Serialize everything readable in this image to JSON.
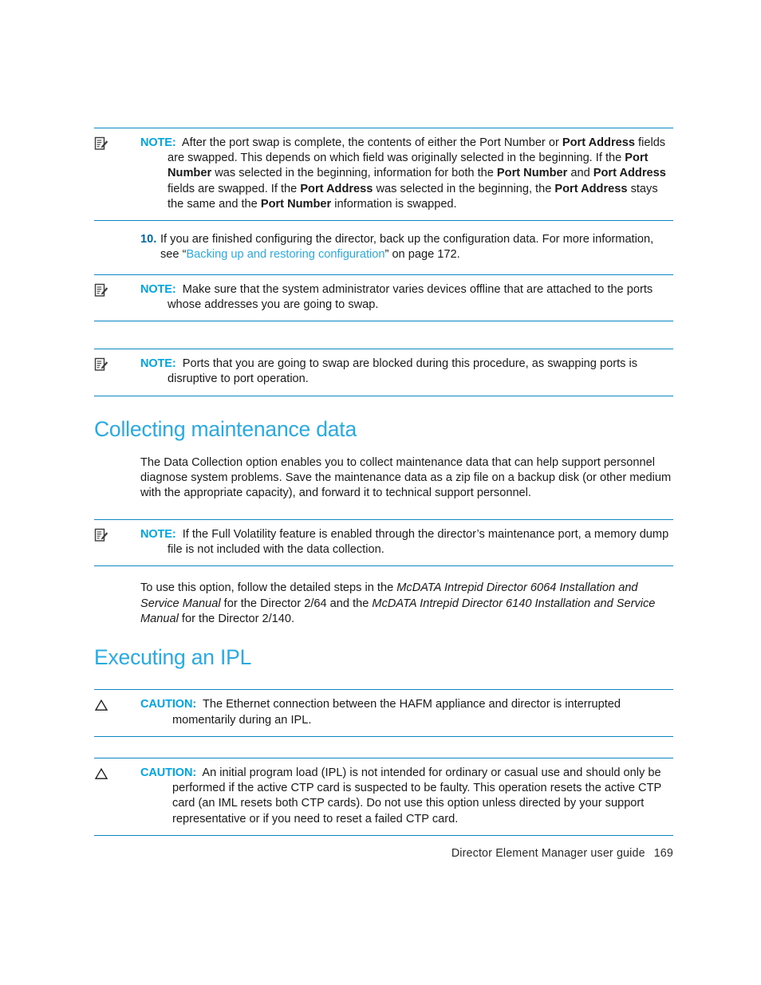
{
  "document": {
    "footer": {
      "guide_title": "Director Element Manager user guide",
      "page_number": "169"
    },
    "colors": {
      "heading": "#29abe2",
      "label": "#00a5e3",
      "rule": "#0d87c4",
      "link": "#29abe2",
      "step_number": "#0069a5",
      "body_text": "#1a1a1a"
    },
    "blocks": [
      {
        "kind": "note",
        "icon": "note-pencil-icon",
        "label": "NOTE:",
        "text": "After the port swap is complete, the contents of either the Port Number or ",
        "runs": [
          {
            "text": "After the port swap is complete, the contents of either the Port Number or ",
            "style": "normal"
          },
          {
            "text": "Port Address",
            "style": "bold"
          },
          {
            "text": " fields are swapped. This depends on which field was originally selected in the beginning. If the ",
            "style": "normal"
          },
          {
            "text": "Port Number",
            "style": "bold"
          },
          {
            "text": " was selected in the beginning, information for both the ",
            "style": "normal"
          },
          {
            "text": "Port Number",
            "style": "bold"
          },
          {
            "text": " and ",
            "style": "normal"
          },
          {
            "text": "Port Address",
            "style": "bold"
          },
          {
            "text": " fields are swapped. If the ",
            "style": "normal"
          },
          {
            "text": "Port Address",
            "style": "bold"
          },
          {
            "text": " was selected in the beginning, the ",
            "style": "normal"
          },
          {
            "text": "Port Address",
            "style": "bold"
          },
          {
            "text": " stays the same and the ",
            "style": "normal"
          },
          {
            "text": "Port Number",
            "style": "bold"
          },
          {
            "text": " information is swapped.",
            "style": "normal"
          }
        ]
      },
      {
        "kind": "step",
        "number": "10.",
        "text_before_link": "If you are finished configuring the director, back up the configuration data. For more information, see “",
        "link_text": "Backing up and restoring configuration",
        "text_after_link": "” on page 172."
      },
      {
        "kind": "note",
        "icon": "note-pencil-icon",
        "label": "NOTE:",
        "text": "Make sure that the system administrator varies devices offline that are attached to the ports whose addresses you are going to swap."
      },
      {
        "kind": "note",
        "icon": "note-pencil-icon",
        "label": "NOTE:",
        "text": "Ports that you are going to swap are blocked during this procedure, as swapping ports is disruptive to port operation."
      },
      {
        "kind": "heading",
        "text": "Collecting maintenance data"
      },
      {
        "kind": "paragraph",
        "text": "The Data Collection option enables you to collect maintenance data that can help support personnel diagnose system problems. Save the maintenance data as a zip file on a backup disk (or other medium with the appropriate capacity), and forward it to technical support personnel."
      },
      {
        "kind": "note",
        "icon": "note-pencil-icon",
        "label": "NOTE:",
        "text": "If the Full Volatility feature is enabled through the director’s maintenance port, a memory dump file is not included with the data collection."
      },
      {
        "kind": "paragraph-mixed",
        "runs": [
          {
            "text": "To use this option, follow the detailed steps in the ",
            "style": "normal"
          },
          {
            "text": "McDATA Intrepid Director 6064 Installation and Service Manual",
            "style": "italic"
          },
          {
            "text": " for the Director 2/64 and the ",
            "style": "normal"
          },
          {
            "text": "McDATA Intrepid Director 6140 Installation and Service Manual",
            "style": "italic"
          },
          {
            "text": " for the Director 2/140.",
            "style": "normal"
          }
        ]
      },
      {
        "kind": "heading",
        "text": "Executing an IPL"
      },
      {
        "kind": "caution",
        "icon": "warning-triangle-icon",
        "label": "CAUTION:",
        "text": "The Ethernet connection between the HAFM appliance and director is interrupted momentarily during an IPL."
      },
      {
        "kind": "caution",
        "icon": "warning-triangle-icon",
        "label": "CAUTION:",
        "text": "An initial program load (IPL) is not intended for ordinary or casual use and should only be performed if the active CTP card is suspected to be faulty. This operation resets the active CTP card (an IML resets both CTP cards). Do not use this option unless directed by your support representative or if you need to reset a failed CTP card."
      }
    ]
  }
}
